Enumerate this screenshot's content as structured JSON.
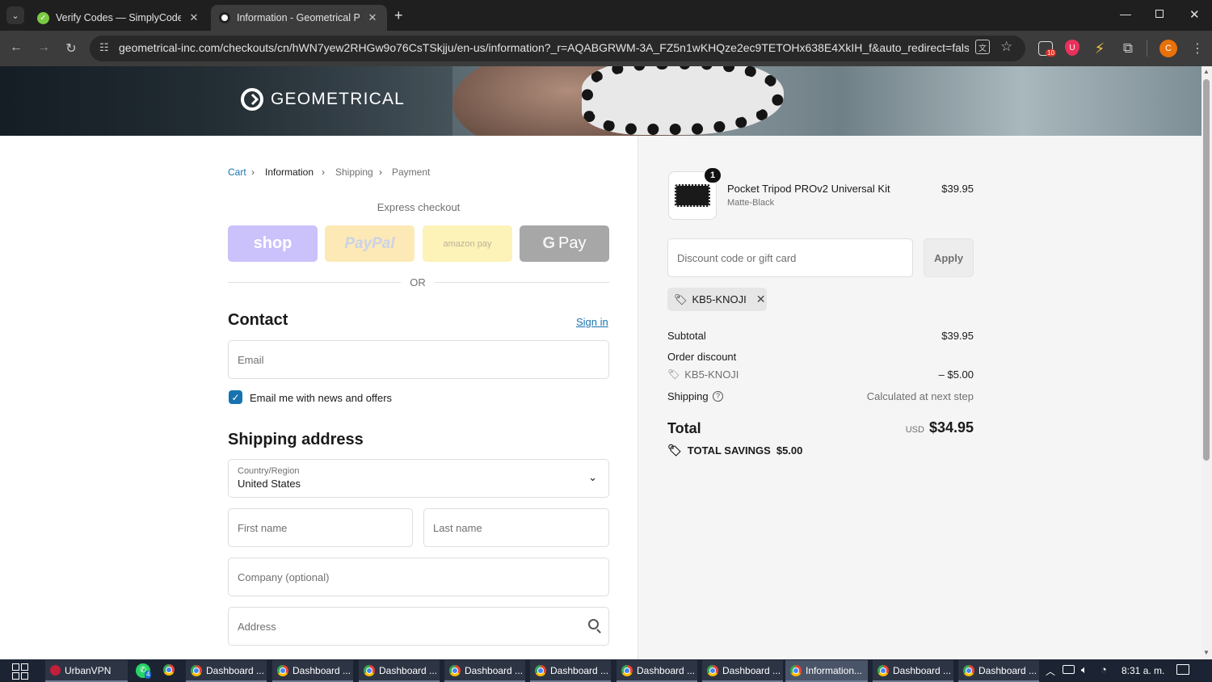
{
  "browser": {
    "tabs": [
      {
        "title": "Verify Codes — SimplyCodes",
        "icon": "simplycodes-icon"
      },
      {
        "title": "Information - Geometrical Pock",
        "icon": "geometrical-favicon"
      }
    ],
    "url": "geometrical-inc.com/checkouts/cn/hWN7yew2RHGw9o76CsTSkjju/en-us/information?_r=AQABGRWM-3A_FZ5n1wKHQze2ec9TETOHx638E4XkIH_f&auto_redirect=false&edge_redi...",
    "extension_badge": "10",
    "profile_initial": "C"
  },
  "store": {
    "name": "GEOMETRICAL"
  },
  "breadcrumb": {
    "cart": "Cart",
    "information": "Information",
    "shipping": "Shipping",
    "payment": "Payment"
  },
  "express": {
    "title": "Express checkout",
    "shop": "shop",
    "paypal": "PayPal",
    "amazon": "amazon pay",
    "gpay": "Pay",
    "or": "OR"
  },
  "contact": {
    "title": "Contact",
    "sign_in": "Sign in",
    "email_placeholder": "Email",
    "newsletter_label": "Email me with news and offers",
    "newsletter_checked": true
  },
  "shipping_address": {
    "title": "Shipping address",
    "country_label": "Country/Region",
    "country_value": "United States",
    "first_name": "First name",
    "last_name": "Last name",
    "company": "Company (optional)",
    "address": "Address"
  },
  "summary": {
    "item": {
      "quantity": "1",
      "name": "Pocket Tripod PROv2 Universal Kit",
      "variant": "Matte-Black",
      "price": "$39.95"
    },
    "discount_placeholder": "Discount code or gift card",
    "apply": "Apply",
    "applied_code": "KB5-KNOJI",
    "subtotal_label": "Subtotal",
    "subtotal": "$39.95",
    "order_discount_label": "Order discount",
    "discount_code": "KB5-KNOJI",
    "discount_amount": "– $5.00",
    "shipping_label": "Shipping",
    "shipping_value": "Calculated at next step",
    "total_label": "Total",
    "currency": "USD",
    "total": "$34.95",
    "savings_label": "TOTAL SAVINGS",
    "savings": "$5.00"
  },
  "taskbar": {
    "urbanvpn": "UrbanVPN",
    "whatsapp_badge": "4",
    "items": [
      "Dashboard ...",
      "Dashboard ...",
      "Dashboard ...",
      "Dashboard ...",
      "Dashboard ...",
      "Dashboard ...",
      "Dashboard ...",
      "Information...",
      "Dashboard ...",
      "Dashboard ..."
    ],
    "clock": "8:31 a. m."
  },
  "colors": {
    "accent": "#1773b0",
    "shop": "#5a31f4",
    "paypal": "#ffc439",
    "amazon": "#ffd814",
    "gpay": "#000000"
  }
}
